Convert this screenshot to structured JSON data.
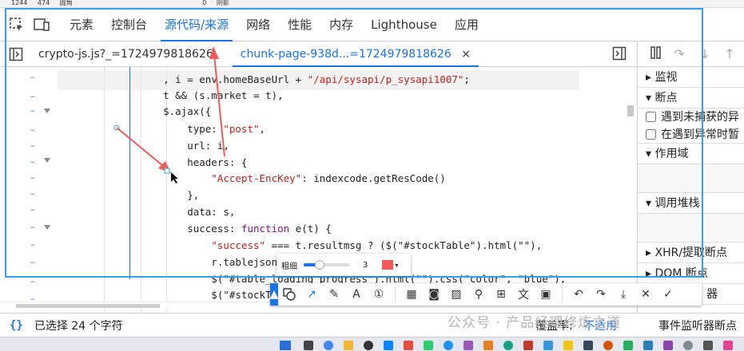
{
  "top_strip": [
    "1244",
    "474",
    "圆角",
    "0",
    "阴影"
  ],
  "main_tabs": [
    "元素",
    "控制台",
    "源代码/来源",
    "网络",
    "性能",
    "内存",
    "Lighthouse",
    "应用"
  ],
  "file_tabs": {
    "file1": "crypto-js.js?_=1724979818626",
    "file2": "chunk-page-938d...=1724979818626",
    "close": "×"
  },
  "code_lines": [
    {
      "pre": "    , i = ",
      "mid": "env.homeBaseUrl + ",
      "str": "\"/api/sysapi/p_sysapi1007\"",
      "post": ";"
    },
    {
      "pre": "    t && (s.market = t),",
      "mid": "",
      "str": "",
      "post": ""
    },
    {
      "pre": "    $.ajax({",
      "mid": "",
      "str": "",
      "post": ""
    },
    {
      "pre": "        type: ",
      "mid": "",
      "str": "\"post\"",
      "post": ","
    },
    {
      "pre": "        url: i,",
      "mid": "",
      "str": "",
      "post": ""
    },
    {
      "pre": "        headers: {",
      "mid": "",
      "str": "",
      "post": ""
    },
    {
      "pre": "            ",
      "mid": "",
      "str": "\"Accept-EncKey\"",
      "post": ": indexcode.getResCode()"
    },
    {
      "pre": "        },",
      "mid": "",
      "str": "",
      "post": ""
    },
    {
      "pre": "        data: s,",
      "mid": "",
      "str": "",
      "post": ""
    },
    {
      "pre": "        success: ",
      "mid": "function",
      "str": "",
      "post": " e(t) {"
    },
    {
      "pre": "            ",
      "mid": "",
      "str": "\"success\"",
      "post": " === t.resultmsg ? ($(\"#stockTable\").html(\"\"),"
    },
    {
      "pre": "            r.tablejsond",
      "mid": "",
      "str": "",
      "post": ""
    },
    {
      "pre": "            $(\"#table_loading_progress\").html(\"\").css(\"color\", \"blue\"),",
      "mid": "",
      "str": "",
      "post": ""
    },
    {
      "pre": "            $(\"#stockTab",
      "mid": "",
      "str": "",
      "post": ""
    }
  ],
  "right_panel": {
    "watch": "监视",
    "breakpoints": "断点",
    "chk1": "遇到未捕获的异",
    "chk2": "在遇到异常时暂",
    "scope": "作用域",
    "callstack": "调用堆栈",
    "xhr": "XHR/提取断点",
    "dom": "DOM 断点",
    "global": "器",
    "events": "事件监听器断点"
  },
  "status": {
    "selection": "已选择 24 个字符",
    "coverage_label": "覆盖率:",
    "coverage_value": "不适用"
  },
  "size_panel": {
    "label": "粗细",
    "value": "3",
    "level_percent": 34
  },
  "watermark": "公众号 · 产品经理修炼之道",
  "colors": {
    "accent": "#1a73e8",
    "string": "#c5221f",
    "keyword": "#881391",
    "annotation": "#f25a5a",
    "frame": "#35a0f0"
  }
}
